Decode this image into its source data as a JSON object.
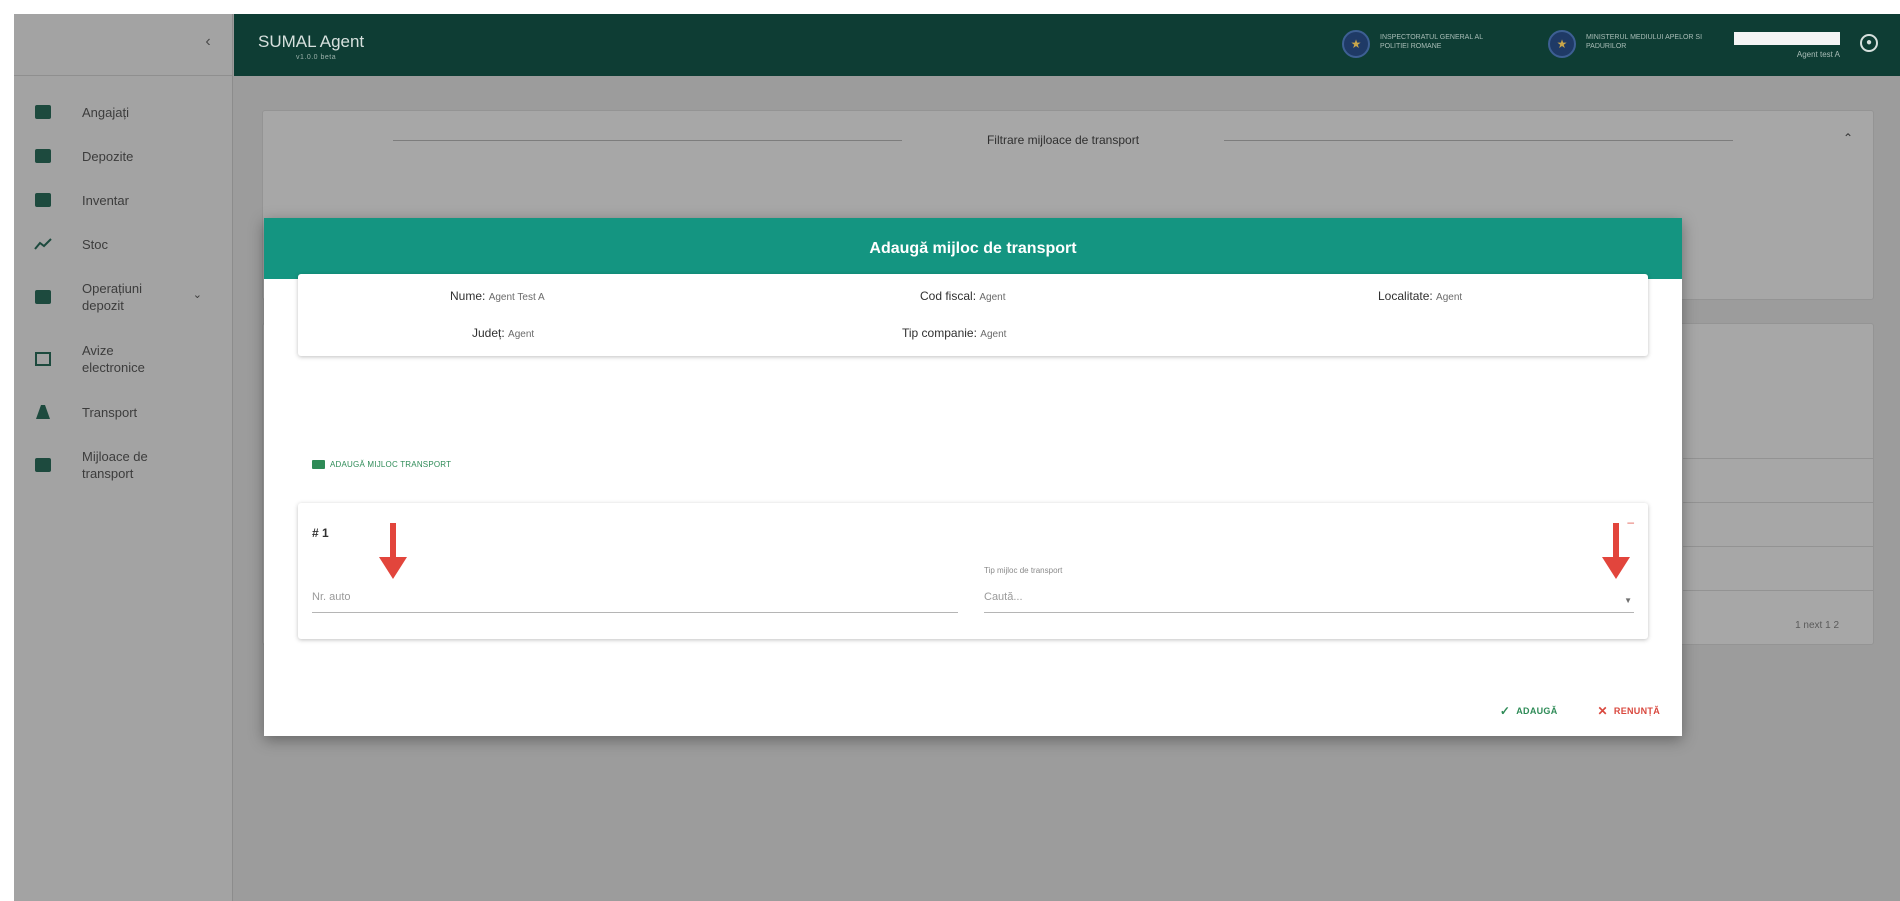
{
  "app": {
    "brand": "SUMAL Agent",
    "brand_sub": "v1.0.0 beta",
    "partner1": "INSPECTORATUL GENERAL AL POLITIEI ROMANE",
    "partner2": "MINISTERUL MEDIULUI APELOR SI PADURILOR",
    "user_role": "Agent test A"
  },
  "sidebar": {
    "collapse_icon": "‹",
    "items": [
      {
        "label": "Angajați",
        "icon": "briefcase-icon"
      },
      {
        "label": "Depozite",
        "icon": "warehouse-icon"
      },
      {
        "label": "Inventar",
        "icon": "inventory-icon"
      },
      {
        "label": "Stoc",
        "icon": "trend-icon"
      },
      {
        "label": "Operațiuni depozit",
        "icon": "grid-icon",
        "chevron": "⌄"
      },
      {
        "label": "Avize electronice",
        "icon": "document-icon"
      },
      {
        "label": "Transport",
        "icon": "road-icon"
      },
      {
        "label": "Mijloace de transport",
        "icon": "car-icon"
      }
    ]
  },
  "background": {
    "filter_title": "Filtrare mijloace de transport",
    "filter_toggle": "⌃",
    "pager": "1 next  1  2"
  },
  "modal": {
    "title": "Adaugă mijloc de transport",
    "info": {
      "name_label": "Nume:",
      "name_value": "Agent Test A",
      "cif_label": "Cod fiscal:",
      "cif_value": "Agent",
      "city_label": "Localitate:",
      "city_value": "Agent",
      "county_label": "Județ:",
      "county_value": "Agent",
      "company_type_label": "Tip companie:",
      "company_type_value": "Agent"
    },
    "add_vehicle_link": "ADAUGĂ MIJLOC TRANSPORT",
    "entry": {
      "number": "# 1",
      "plate_placeholder": "Nr. auto",
      "type_label": "Tip mijloc de transport",
      "type_placeholder": "Caută...",
      "remove": "–"
    },
    "buttons": {
      "add": "ADAUGĂ",
      "cancel": "RENUNȚĂ"
    }
  },
  "colors": {
    "topbar": "#0e3d34",
    "modal_header": "#149581",
    "annotation_arrow": "#e2453c",
    "add_green": "#2e8b57",
    "cancel_red": "#d9473d"
  }
}
